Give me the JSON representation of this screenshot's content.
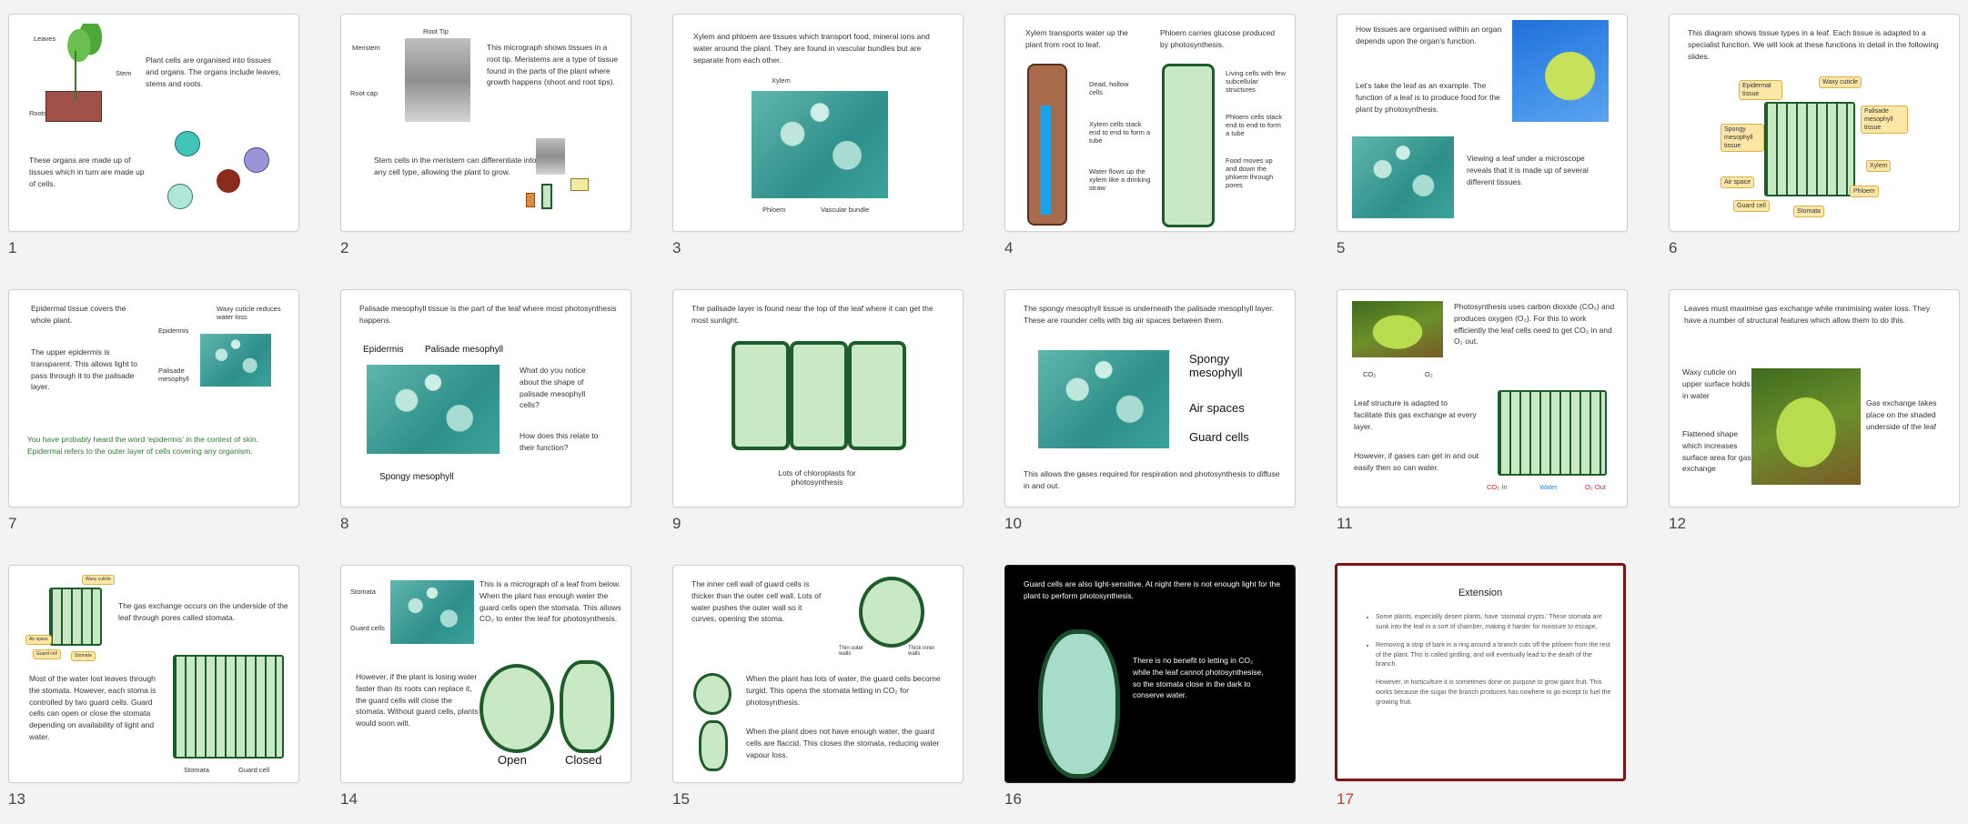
{
  "slides": [
    {
      "number": "1",
      "texts": [
        "Plant cells are organised into tissues and organs. The organs include leaves, stems and roots.",
        "These organs are made up of tissues which in turn are made up of cells."
      ],
      "labels": [
        "Leaves",
        "Stem",
        "Roots"
      ]
    },
    {
      "number": "2",
      "texts": [
        "This micrograph shows tissues in a root tip. Meristems are a type of tissue found in the parts of the plant where growth happens (shoot and root tips).",
        "Stem cells in the meristem can differentiate into any cell type, allowing the plant to grow."
      ],
      "labels": [
        "Root Tip",
        "Meristem",
        "Root cap"
      ]
    },
    {
      "number": "3",
      "texts": [
        "Xylem and phloem are tissues which transport food, mineral ions and water around the plant. They are found in vascular bundles but are separate from each other."
      ],
      "labels": [
        "Xylem",
        "Phloem",
        "Vascular bundle"
      ]
    },
    {
      "number": "4",
      "texts": [
        "Xylem transports water up the plant from root to leaf.",
        "Phloem carries glucose produced by photosynthesis."
      ],
      "labels": [
        "Dead, hollow cells",
        "Xylem cells stack end to end to form a tube",
        "Water flows up the xylem like a drinking straw",
        "Living cells with few subcellular structures",
        "Phloem cells stack end to end to form a tube",
        "Food moves up and down the phloem through pores"
      ]
    },
    {
      "number": "5",
      "texts": [
        "How tissues are organised within an organ depends upon the organ’s function.",
        "Let’s take the leaf as an example. The function of a leaf is to produce food for the plant by photosynthesis.",
        "Viewing a leaf under a microscope reveals that it is made up of several different tissues."
      ]
    },
    {
      "number": "6",
      "texts": [
        "This diagram shows tissue types in a leaf. Each tissue is adapted to a specialist function. We will look at these functions in detail in the following slides."
      ],
      "labels": [
        "Epidermal tissue",
        "Waxy cuticle",
        "Palisade mesophyll tissue",
        "Spongy mesophyll tissue",
        "Xylem",
        "Air space",
        "Phloem",
        "Guard cell",
        "Stomata"
      ]
    },
    {
      "number": "7",
      "texts": [
        "Epidermal tissue covers the whole plant.",
        "The upper epidermis is transparent. This allows light to pass through it to the palisade layer.",
        "You have probably heard the word ‘epidermis’ in the context of skin. Epidermal refers to the outer layer of cells covering any organism."
      ],
      "labels": [
        "Waxy cuticle reduces water loss",
        "Epidermis",
        "Palisade mesophyll"
      ]
    },
    {
      "number": "8",
      "texts": [
        "Palisade mesophyll tissue is the part of the leaf where most photosynthesis happens.",
        "What do you notice about the shape of palisade mesophyll cells?",
        "How does this relate to their function?"
      ],
      "labels": [
        "Epidermis",
        "Palisade mesophyll",
        "Spongy mesophyll"
      ]
    },
    {
      "number": "9",
      "texts": [
        "The palisade layer is found near the top of the leaf where it can get the most sunlight."
      ],
      "labels": [
        "Lots of chloroplasts for photosynthesis"
      ]
    },
    {
      "number": "10",
      "texts": [
        "The spongy mesophyll tissue is underneath the palisade mesophyll layer. These are rounder cells with big air spaces between them.",
        "This allows the gases required for respiration and photosynthesis to diffuse in and out."
      ],
      "labels": [
        "Spongy mesophyll",
        "Air spaces",
        "Guard cells"
      ]
    },
    {
      "number": "11",
      "texts": [
        "Photosynthesis uses carbon dioxide (CO₂) and produces oxygen (O₂). For this to work efficiently the leaf cells need to get CO₂ in and O₂ out.",
        "Leaf structure is adapted to facilitate this gas exchange at every layer.",
        "However, if gases can get in and out easily then so can water."
      ],
      "labels": [
        "CO₂",
        "O₂",
        "CO₂ In",
        "Water",
        "O₂ Out"
      ]
    },
    {
      "number": "12",
      "texts": [
        "Leaves must maximise gas exchange while minimising water loss. They have a number of structural features which allow them to do this.",
        "Waxy cuticle on upper surface holds in water",
        "Flattened shape which increases surface area for gas exchange",
        "Gas exchange takes place on the shaded underside of the leaf"
      ]
    },
    {
      "number": "13",
      "texts": [
        "The gas exchange occurs on the underside of the leaf through pores called stomata.",
        "Most of the water lost leaves through the stomata. However, each stoma is controlled by two guard cells. Guard cells can open or close the stomata depending on availability of light and water."
      ],
      "labels": [
        "Waxy cuticle",
        "Air space",
        "Guard cell",
        "Stomata",
        "Stomata",
        "Guard cell"
      ]
    },
    {
      "number": "14",
      "texts": [
        "This is a micrograph of a leaf from below. When the plant has enough water the guard cells open the stomata. This allows CO₂ to enter the leaf for photosynthesis.",
        "However, if the plant is losing water faster than its roots can replace it, the guard cells will close the stomata. Without guard cells, plants would soon wilt."
      ],
      "labels": [
        "Stomata",
        "Guard cells",
        "Open",
        "Closed"
      ]
    },
    {
      "number": "15",
      "texts": [
        "The inner cell wall of guard cells is thicker than the outer cell wall. Lots of water pushes the outer wall so it curves, opening the stoma.",
        "When the plant has lots of water, the guard cells become turgid. This opens the stomata letting in CO₂ for photosynthesis.",
        "When the plant does not have enough water, the guard cells are flaccid. This closes the stomata, reducing water vapour loss."
      ],
      "labels": [
        "Thin outer walls",
        "Thick inner walls"
      ]
    },
    {
      "number": "16",
      "texts": [
        "Guard cells are also light-sensitive. At night there is not enough light for the plant to perform photosynthesis.",
        "There is no benefit to letting in CO₂ while the leaf cannot photosynthesise, so the stomata close in the dark to conserve water."
      ]
    },
    {
      "number": "17",
      "title": "Extension",
      "bullets": [
        "Some plants, especially desert plants, have ‘stomatal crypts.’ These stomata are sunk into the leaf in a sort of chamber, making it harder for moisture to escape.",
        "Removing a strip of bark in a ring around a branch cuts off the phloem from the rest of the plant. This is called girdling, and will eventually lead to the death of the branch.",
        "However, in horticulture it is sometimes done on purpose to grow giant fruit. This works because the sugar the branch produces has nowhere to go except to fuel the growing fruit."
      ]
    }
  ],
  "selected_slide": "17",
  "colors": {
    "background": "#f3f3f3",
    "selected_border": "#7a1616",
    "selected_number": "#c0392b",
    "leaf_green": "#2e7d32"
  }
}
